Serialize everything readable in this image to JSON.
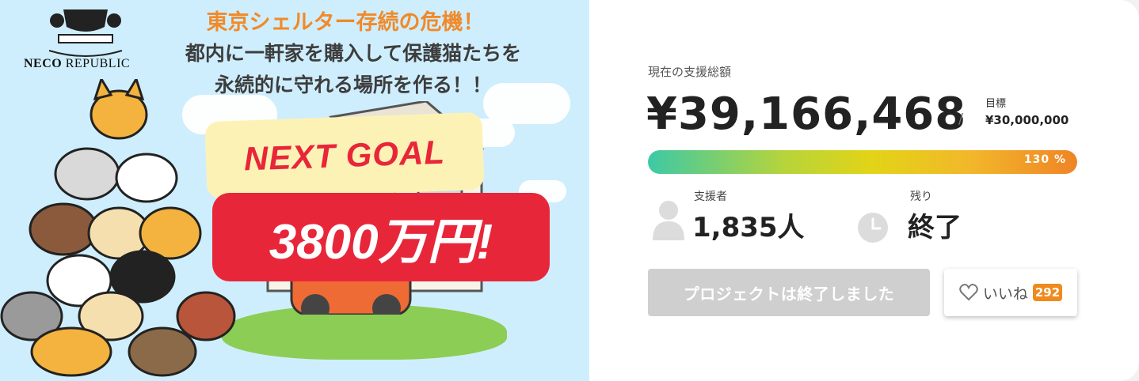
{
  "banner": {
    "logo_main": "NECO",
    "logo_sub": "REPUBLIC",
    "headline": "東京シェルター存続の危機！",
    "subline1": "都内に一軒家を購入して保護猫たちを",
    "subline2": "永続的に守れる場所を作る！！",
    "goal_label": "NEXT GOAL",
    "goal_amount": "3800万円!",
    "colors": {
      "headline": "#f08a2a",
      "goal_red": "#e8263a",
      "goal_yellow": "#fdf2b6",
      "sky": "#cfeefd"
    }
  },
  "funding": {
    "total_label": "現在の支援総額",
    "total_amount": "¥39,166,468",
    "separator": "/",
    "goal_label": "目標",
    "goal_amount": "¥30,000,000",
    "progress_text": "130 %",
    "progress_fraction": 1.0
  },
  "stats": {
    "supporters_label": "支援者",
    "supporters_value": "1,835人",
    "supporters_icon": "person-icon",
    "remaining_label": "残り",
    "remaining_value": "終了",
    "remaining_icon": "clock-icon"
  },
  "actions": {
    "ended_label": "プロジェクトは終了しました",
    "like_label": "いいね",
    "like_count": "292",
    "like_icon": "heart-icon",
    "accent": "#f08a1c"
  }
}
